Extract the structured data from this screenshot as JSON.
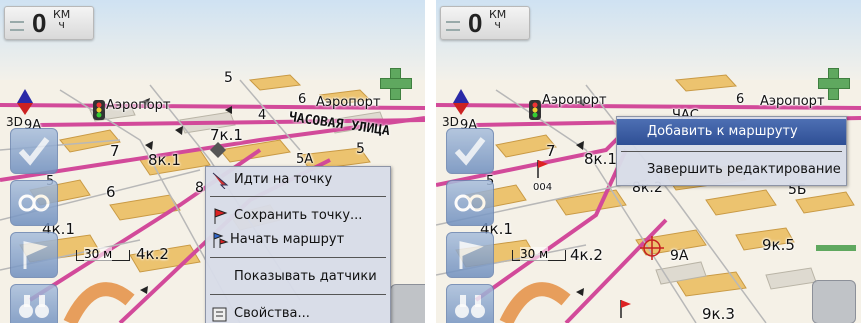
{
  "speed": {
    "value": "0",
    "unit_top": "КМ",
    "unit_bottom": "ч"
  },
  "left_panel": {
    "labels": {
      "lbl_5a": "5",
      "lbl_6": "6",
      "lbl_aero1": "Аэропорт",
      "lbl_aero2": "Аэропорт",
      "lbl_9a": "9А",
      "lbl_4": "4",
      "lbl_7k1": "7к.1",
      "lbl_7": "7",
      "lbl_8k1": "8к.1",
      "lbl_5b": "5",
      "lbl_5c": "5А",
      "lbl_6b": "6",
      "lbl_8": "8",
      "lbl_5d": "5",
      "lbl_4k1": "4к.1",
      "lbl_4k2": "4к.2"
    },
    "street": "ЧАСОВАЯ УЛИЦА",
    "compass_label": "3D",
    "scale": "30 м",
    "menu": {
      "go_to_point": "Идти на точку",
      "save_point": "Сохранить точку...",
      "start_route": "Начать маршрут",
      "show_sensors": "Показывать датчики",
      "properties": "Свойства..."
    }
  },
  "right_panel": {
    "labels": {
      "lbl_aero1": "Аэропорт",
      "lbl_aero2": "Аэропорт",
      "lbl_6": "6",
      "lbl_9a": "9А",
      "lbl_5": "5",
      "lbl_7": "7",
      "lbl_8k1": "8к.1",
      "lbl_8k2": "8к.2",
      "lbl_5b": "5Б",
      "lbl_9a2": "9А",
      "lbl_9k5": "9к.5",
      "lbl_4k1": "4к.1",
      "lbl_4k2": "4к.2",
      "lbl_9k3": "9к.3",
      "lbl_004": "004",
      "lbl_hal": "ЧАС"
    },
    "compass_label": "3D",
    "scale": "30 м",
    "menu": {
      "add_to_route": "Добавить к маршруту",
      "finish_editing": "Завершить редактирование"
    }
  },
  "colors": {
    "road": "#d24a9a",
    "menu_bg": "#d7dce8",
    "highlight": "#3a5ba3",
    "building": "#e8b35a"
  }
}
